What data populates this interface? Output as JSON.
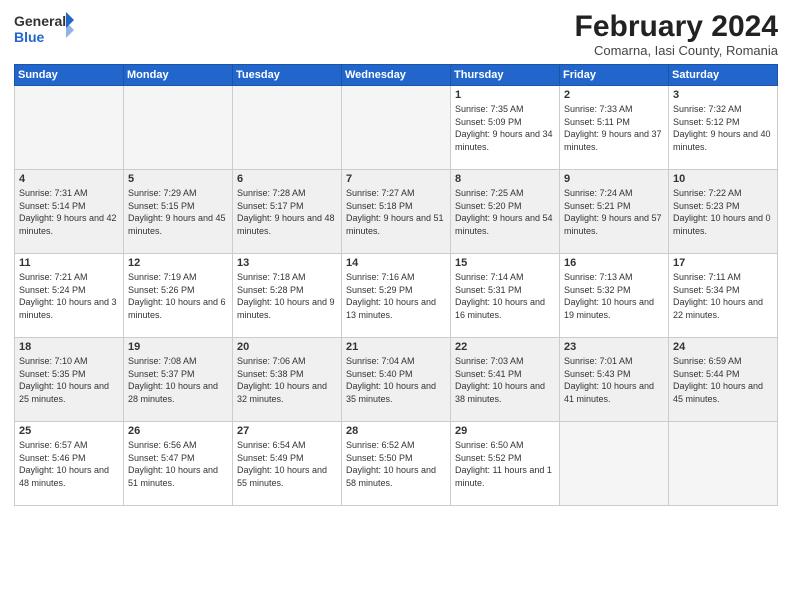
{
  "header": {
    "logo_general": "General",
    "logo_blue": "Blue",
    "month_year": "February 2024",
    "location": "Comarna, Iasi County, Romania"
  },
  "days_of_week": [
    "Sunday",
    "Monday",
    "Tuesday",
    "Wednesday",
    "Thursday",
    "Friday",
    "Saturday"
  ],
  "weeks": [
    [
      {
        "day": "",
        "info": ""
      },
      {
        "day": "",
        "info": ""
      },
      {
        "day": "",
        "info": ""
      },
      {
        "day": "",
        "info": ""
      },
      {
        "day": "1",
        "info": "Sunrise: 7:35 AM\nSunset: 5:09 PM\nDaylight: 9 hours and 34 minutes."
      },
      {
        "day": "2",
        "info": "Sunrise: 7:33 AM\nSunset: 5:11 PM\nDaylight: 9 hours and 37 minutes."
      },
      {
        "day": "3",
        "info": "Sunrise: 7:32 AM\nSunset: 5:12 PM\nDaylight: 9 hours and 40 minutes."
      }
    ],
    [
      {
        "day": "4",
        "info": "Sunrise: 7:31 AM\nSunset: 5:14 PM\nDaylight: 9 hours and 42 minutes."
      },
      {
        "day": "5",
        "info": "Sunrise: 7:29 AM\nSunset: 5:15 PM\nDaylight: 9 hours and 45 minutes."
      },
      {
        "day": "6",
        "info": "Sunrise: 7:28 AM\nSunset: 5:17 PM\nDaylight: 9 hours and 48 minutes."
      },
      {
        "day": "7",
        "info": "Sunrise: 7:27 AM\nSunset: 5:18 PM\nDaylight: 9 hours and 51 minutes."
      },
      {
        "day": "8",
        "info": "Sunrise: 7:25 AM\nSunset: 5:20 PM\nDaylight: 9 hours and 54 minutes."
      },
      {
        "day": "9",
        "info": "Sunrise: 7:24 AM\nSunset: 5:21 PM\nDaylight: 9 hours and 57 minutes."
      },
      {
        "day": "10",
        "info": "Sunrise: 7:22 AM\nSunset: 5:23 PM\nDaylight: 10 hours and 0 minutes."
      }
    ],
    [
      {
        "day": "11",
        "info": "Sunrise: 7:21 AM\nSunset: 5:24 PM\nDaylight: 10 hours and 3 minutes."
      },
      {
        "day": "12",
        "info": "Sunrise: 7:19 AM\nSunset: 5:26 PM\nDaylight: 10 hours and 6 minutes."
      },
      {
        "day": "13",
        "info": "Sunrise: 7:18 AM\nSunset: 5:28 PM\nDaylight: 10 hours and 9 minutes."
      },
      {
        "day": "14",
        "info": "Sunrise: 7:16 AM\nSunset: 5:29 PM\nDaylight: 10 hours and 13 minutes."
      },
      {
        "day": "15",
        "info": "Sunrise: 7:14 AM\nSunset: 5:31 PM\nDaylight: 10 hours and 16 minutes."
      },
      {
        "day": "16",
        "info": "Sunrise: 7:13 AM\nSunset: 5:32 PM\nDaylight: 10 hours and 19 minutes."
      },
      {
        "day": "17",
        "info": "Sunrise: 7:11 AM\nSunset: 5:34 PM\nDaylight: 10 hours and 22 minutes."
      }
    ],
    [
      {
        "day": "18",
        "info": "Sunrise: 7:10 AM\nSunset: 5:35 PM\nDaylight: 10 hours and 25 minutes."
      },
      {
        "day": "19",
        "info": "Sunrise: 7:08 AM\nSunset: 5:37 PM\nDaylight: 10 hours and 28 minutes."
      },
      {
        "day": "20",
        "info": "Sunrise: 7:06 AM\nSunset: 5:38 PM\nDaylight: 10 hours and 32 minutes."
      },
      {
        "day": "21",
        "info": "Sunrise: 7:04 AM\nSunset: 5:40 PM\nDaylight: 10 hours and 35 minutes."
      },
      {
        "day": "22",
        "info": "Sunrise: 7:03 AM\nSunset: 5:41 PM\nDaylight: 10 hours and 38 minutes."
      },
      {
        "day": "23",
        "info": "Sunrise: 7:01 AM\nSunset: 5:43 PM\nDaylight: 10 hours and 41 minutes."
      },
      {
        "day": "24",
        "info": "Sunrise: 6:59 AM\nSunset: 5:44 PM\nDaylight: 10 hours and 45 minutes."
      }
    ],
    [
      {
        "day": "25",
        "info": "Sunrise: 6:57 AM\nSunset: 5:46 PM\nDaylight: 10 hours and 48 minutes."
      },
      {
        "day": "26",
        "info": "Sunrise: 6:56 AM\nSunset: 5:47 PM\nDaylight: 10 hours and 51 minutes."
      },
      {
        "day": "27",
        "info": "Sunrise: 6:54 AM\nSunset: 5:49 PM\nDaylight: 10 hours and 55 minutes."
      },
      {
        "day": "28",
        "info": "Sunrise: 6:52 AM\nSunset: 5:50 PM\nDaylight: 10 hours and 58 minutes."
      },
      {
        "day": "29",
        "info": "Sunrise: 6:50 AM\nSunset: 5:52 PM\nDaylight: 11 hours and 1 minute."
      },
      {
        "day": "",
        "info": ""
      },
      {
        "day": "",
        "info": ""
      }
    ]
  ]
}
